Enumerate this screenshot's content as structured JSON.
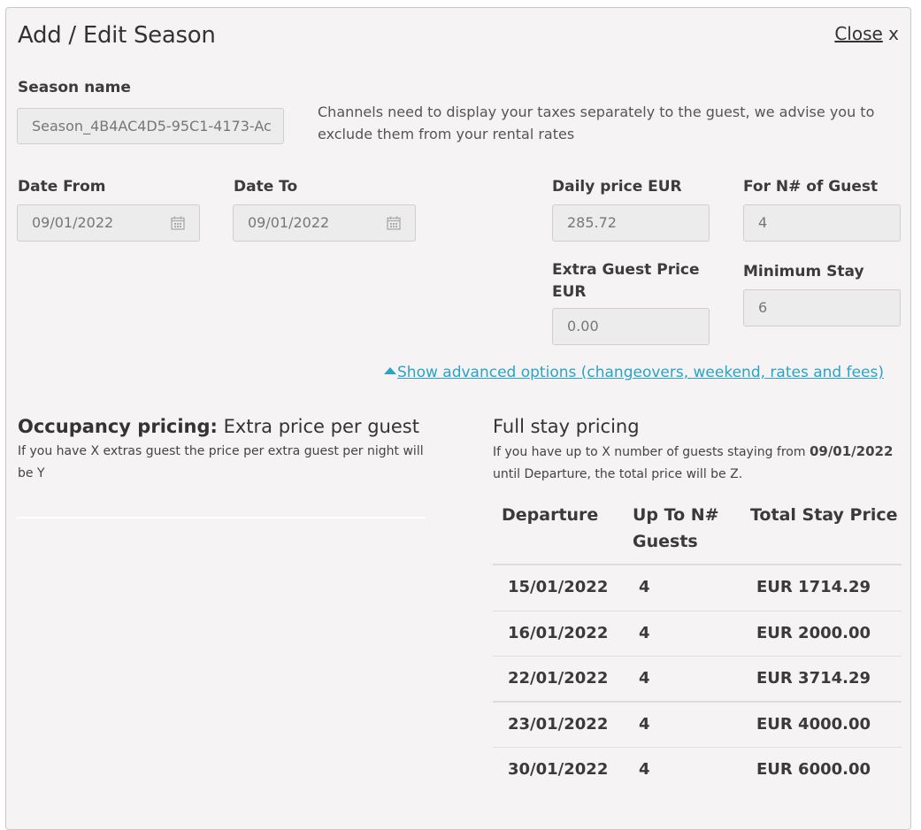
{
  "modal": {
    "title": "Add / Edit Season",
    "close_label": "Close",
    "close_x": "x"
  },
  "season": {
    "label": "Season name",
    "value": "Season_4B4AC4D5-95C1-4173-Ac",
    "tax_note": "Channels need to display your taxes separately to the guest, we advise you to exclude them from your rental rates"
  },
  "dates": {
    "from_label": "Date From",
    "from_value": "09/01/2022",
    "to_label": "Date To",
    "to_value": "09/01/2022"
  },
  "pricing": {
    "daily_label": "Daily price EUR",
    "daily_value": "285.72",
    "guests_label": "For N# of Guest",
    "guests_value": "4",
    "extra_label_1": "Extra Guest Price",
    "extra_label_2": "EUR",
    "extra_value": "0.00",
    "min_stay_label": "Minimum Stay",
    "min_stay_value": "6"
  },
  "advanced": {
    "link_label": "Show advanced options (changeovers, weekend, rates and fees)"
  },
  "occupancy": {
    "title_bold": "Occupancy pricing:",
    "title_rest": " Extra price per guest",
    "desc_line1": "If you have X extras guest the price per extra guest per night will",
    "desc_line2": "be Y"
  },
  "full_stay": {
    "title": "Full stay pricing",
    "desc_pre": "If you have up to X number of guests staying from ",
    "desc_date": "09/01/2022",
    "desc_line2": "until Departure, the total price will be Z.",
    "columns": [
      "Departure",
      "Up To N#",
      "Guests",
      "Total Stay Price"
    ],
    "rows": [
      {
        "departure": "15/01/2022",
        "guests": "4",
        "price": "EUR 1714.29"
      },
      {
        "departure": "16/01/2022",
        "guests": "4",
        "price": "EUR 2000.00"
      },
      {
        "departure": "22/01/2022",
        "guests": "4",
        "price": "EUR 3714.29"
      },
      {
        "departure": "23/01/2022",
        "guests": "4",
        "price": "EUR 4000.00"
      },
      {
        "departure": "30/01/2022",
        "guests": "4",
        "price": "EUR 6000.00"
      }
    ]
  },
  "colors": {
    "background": "#f5f3f4",
    "accent_link": "#2aa3c5",
    "input_bg": "#ececec"
  }
}
